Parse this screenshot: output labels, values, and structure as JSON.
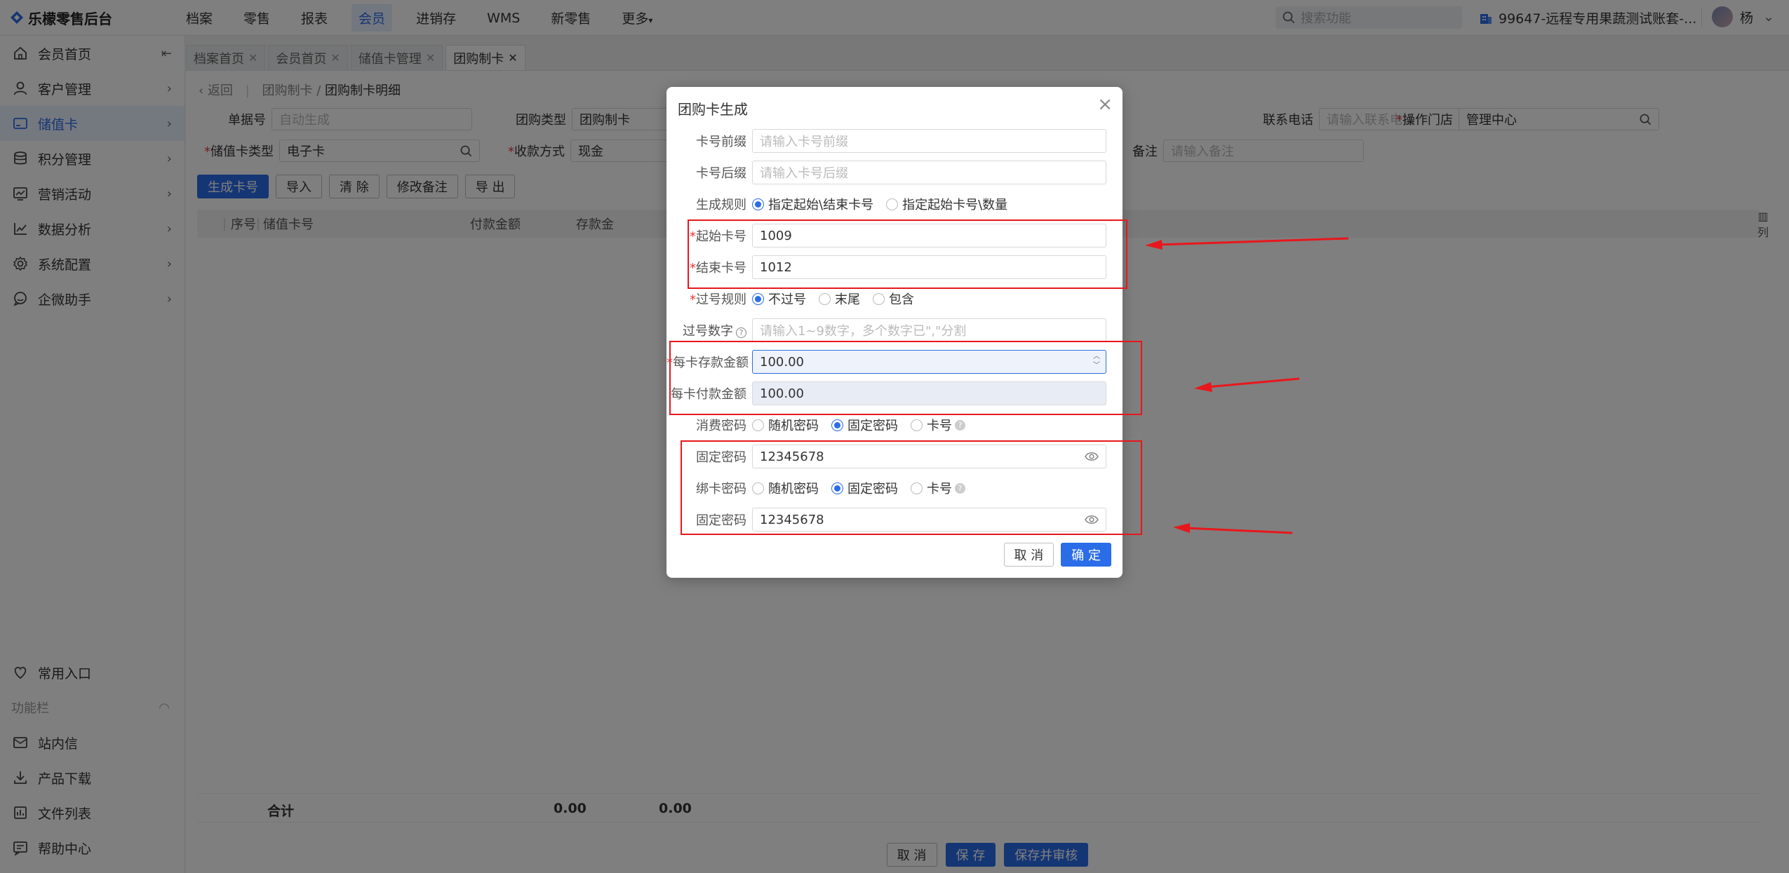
{
  "app": {
    "title": "乐檬零售后台"
  },
  "topnav": [
    "档案",
    "零售",
    "报表",
    "会员",
    "进销存",
    "WMS",
    "新零售",
    "更多"
  ],
  "topnav_active": "会员",
  "search": {
    "placeholder": "搜索功能"
  },
  "account": {
    "name": "99647-远程专用果蔬测试账套-..."
  },
  "user": {
    "name": "杨"
  },
  "sidebar": {
    "items": [
      {
        "label": "会员首页",
        "icon": "home-icon"
      },
      {
        "label": "客户管理",
        "icon": "user-icon"
      },
      {
        "label": "储值卡",
        "icon": "card-icon"
      },
      {
        "label": "积分管理",
        "icon": "database-icon"
      },
      {
        "label": "营销活动",
        "icon": "marketing-icon"
      },
      {
        "label": "数据分析",
        "icon": "chart-icon"
      },
      {
        "label": "系统配置",
        "icon": "gear-icon"
      },
      {
        "label": "企微助手",
        "icon": "chat-icon"
      }
    ],
    "bottom": [
      {
        "label": "常用入口",
        "icon": "heart-icon"
      },
      {
        "label": "站内信",
        "icon": "mail-icon"
      },
      {
        "label": "产品下载",
        "icon": "download-icon"
      },
      {
        "label": "文件列表",
        "icon": "file-icon"
      },
      {
        "label": "帮助中心",
        "icon": "help-icon"
      }
    ],
    "section": "功能栏"
  },
  "tabs": [
    "档案首页",
    "会员首页",
    "储值卡管理",
    "团购制卡"
  ],
  "breadcrumb": {
    "back": "返回",
    "parent": "团购制卡",
    "current": "团购制卡明细"
  },
  "form": {
    "doc_no_label": "单据号",
    "doc_no_placeholder": "自动生成",
    "type_label": "团购类型",
    "type_value": "团购制卡",
    "phone_label": "联系电话",
    "phone_placeholder": "请输入联系电话",
    "store_label": "操作门店",
    "store_value": "管理中心",
    "card_type_label": "储值卡类型",
    "card_type_value": "电子卡",
    "payment_label": "收款方式",
    "payment_value": "现金",
    "remark_label": "备注",
    "remark_placeholder": "请输入备注"
  },
  "actions": [
    "生成卡号",
    "导入",
    "清 除",
    "修改备注",
    "导 出"
  ],
  "table": {
    "headers": [
      "序号",
      "储值卡号",
      "付款金额",
      "存款金"
    ],
    "column_settings": "列",
    "footer": {
      "label": "合计",
      "pay_total": "0.00",
      "deposit_total": "0.00"
    }
  },
  "bottom_buttons": [
    "取 消",
    "保 存",
    "保存并审核"
  ],
  "modal": {
    "title": "团购卡生成",
    "prefix_label": "卡号前缀",
    "prefix_placeholder": "请输入卡号前缀",
    "suffix_label": "卡号后缀",
    "suffix_placeholder": "请输入卡号后缀",
    "rule_label": "生成规则",
    "rule_opt1": "指定起始\\结束卡号",
    "rule_opt2": "指定起始卡号\\数量",
    "start_label": "起始卡号",
    "start_value": "1009",
    "end_label": "结束卡号",
    "end_value": "1012",
    "skip_label": "过号规则",
    "skip_opt1": "不过号",
    "skip_opt2": "末尾",
    "skip_opt3": "包含",
    "skip_digits_label": "过号数字",
    "skip_digits_placeholder": "请输入1~9数字，多个数字已\",\"分割",
    "deposit_label": "每卡存款金额",
    "deposit_value": "100.00",
    "pay_label": "每卡付款金额",
    "pay_value": "100.00",
    "consume_pwd_label": "消费密码",
    "pwd_opt1": "随机密码",
    "pwd_opt2": "固定密码",
    "pwd_opt3": "卡号",
    "fixed_pwd_label": "固定密码",
    "fixed_pwd_value": "12345678",
    "bind_pwd_label": "绑卡密码",
    "fixed_pwd2_label": "固定密码",
    "fixed_pwd2_value": "12345678",
    "cancel": "取 消",
    "confirm": "确 定"
  },
  "colors": {
    "accent": "#2b6de8",
    "annotation": "#e8171c"
  }
}
